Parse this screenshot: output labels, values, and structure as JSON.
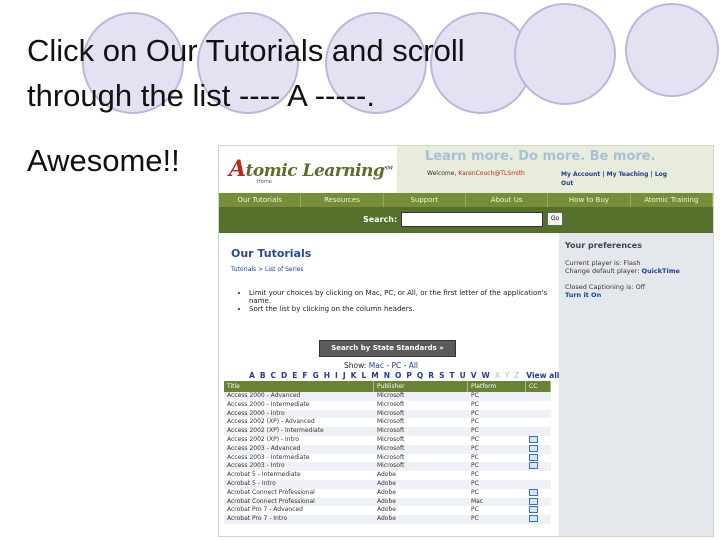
{
  "slide": {
    "line1": "Click on Our Tutorials and scroll",
    "line2": "through the list ---- A -----.",
    "line3": "Awesome!!"
  },
  "colors": {
    "circle_fill": "#e3e2f3",
    "circle_stroke": "#b9b8dc",
    "nav_green": "#758e37",
    "search_green": "#54702a",
    "link_blue": "#1d3d97",
    "sidebar_bg": "#e4e8ec"
  },
  "site": {
    "logo_a": "A",
    "logo_text": "tomic Learning",
    "logo_sm": "SM",
    "logo_home": "Home",
    "tagline": "Learn more. Do more. Be more.",
    "welcome_label": "Welcome,",
    "welcome_user": "KarenCouch@TLSmith",
    "account_links": "My Account | My Teaching | Log",
    "account_links2": "Out",
    "nav": [
      "Our Tutorials",
      "Resources",
      "Support",
      "About Us",
      "How to Buy",
      "Atomic Training"
    ],
    "search_label": "Search:",
    "search_value": "",
    "go_label": "Go"
  },
  "main": {
    "title": "Our Tutorials",
    "crumb": "Tutorials > List of Series",
    "bullets": [
      "Limit your choices by clicking on Mac, PC, or All, or the first letter of the application's name.",
      "Sort the list by clicking on the column headers."
    ],
    "standards_button": "Search by State Standards »",
    "show_label": "Show:",
    "show_mac": "Mac",
    "show_pc": "PC",
    "show_all": "All",
    "sep": "-",
    "letters_active": "A B C D E F G H I J K L M N O P Q R S T U V W",
    "letters_dim": "X Y Z",
    "view_all": "View all"
  },
  "table": {
    "headers": [
      "Title",
      "Publisher",
      "Platform",
      "CC"
    ],
    "rows": [
      [
        "Access 2000 - Advanced",
        "Microsoft",
        "PC",
        ""
      ],
      [
        "Access 2000 - Intermediate",
        "Microsoft",
        "PC",
        ""
      ],
      [
        "Access 2000 - Intro",
        "Microsoft",
        "PC",
        ""
      ],
      [
        "Access 2002 (XP) - Advanced",
        "Microsoft",
        "PC",
        ""
      ],
      [
        "Access 2002 (XP) - Intermediate",
        "Microsoft",
        "PC",
        ""
      ],
      [
        "Access 2002 (XP) - Intro",
        "Microsoft",
        "PC",
        "cc"
      ],
      [
        "Access 2003 - Advanced",
        "Microsoft",
        "PC",
        "cc"
      ],
      [
        "Access 2003 - Intermediate",
        "Microsoft",
        "PC",
        "cc"
      ],
      [
        "Access 2003 - Intro",
        "Microsoft",
        "PC",
        "cc"
      ],
      [
        "Acrobat 5 - Intermediate",
        "Adobe",
        "PC",
        ""
      ],
      [
        "Acrobat 5 - Intro",
        "Adobe",
        "PC",
        ""
      ],
      [
        "Acrobat Connect Professional",
        "Adobe",
        "PC",
        "cc"
      ],
      [
        "Acrobat Connect Professional",
        "Adobe",
        "Mac",
        "cc"
      ],
      [
        "Acrobat Pro 7 - Advanced",
        "Adobe",
        "PC",
        "cc"
      ],
      [
        "Acrobat Pro 7 - Intro",
        "Adobe",
        "PC",
        "cc"
      ]
    ]
  },
  "sidebar": {
    "heading": "Your preferences",
    "player_label": "Current player is: Flash",
    "player_change": "Change default player:",
    "player_link": "QuickTime",
    "cc_label": "Closed Captioning is: Off",
    "cc_link": "Turn it On"
  }
}
